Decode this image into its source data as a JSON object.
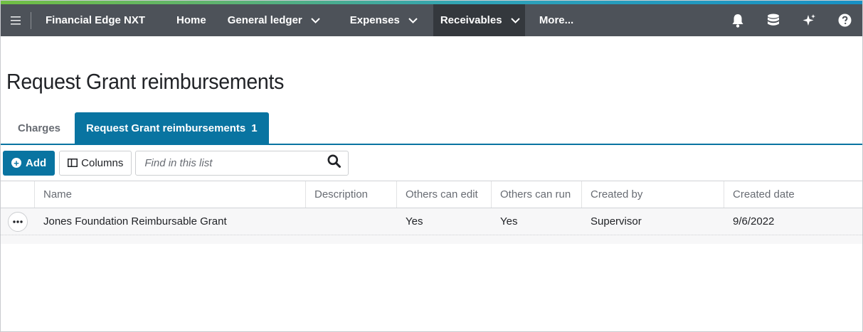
{
  "app": {
    "title": "Financial Edge NXT",
    "colors": {
      "nav_bg": "#4d5259",
      "accent": "#0974a1",
      "active_nav": "#34383d"
    }
  },
  "nav": {
    "items": [
      {
        "label": "Home",
        "has_dropdown": false
      },
      {
        "label": "General ledger",
        "has_dropdown": true
      },
      {
        "label": "Expenses",
        "has_dropdown": true
      },
      {
        "label": "Receivables",
        "has_dropdown": true,
        "active": true
      },
      {
        "label": "More...",
        "has_dropdown": false
      }
    ],
    "right_icons": [
      "bell-icon",
      "database-icon",
      "sparkle-icon",
      "help-icon"
    ]
  },
  "page": {
    "title": "Request Grant reimbursements"
  },
  "tabs": [
    {
      "label": "Charges",
      "count": ""
    },
    {
      "label": "Request Grant reimbursements",
      "count": "1",
      "active": true
    }
  ],
  "toolbar": {
    "add_label": "Add",
    "columns_label": "Columns",
    "search_placeholder": "Find in this list"
  },
  "grid": {
    "columns": [
      "Name",
      "Description",
      "Others can edit",
      "Others can run",
      "Created by",
      "Created date"
    ],
    "rows": [
      {
        "name": "Jones Foundation Reimbursable Grant",
        "description": "",
        "others_can_edit": "Yes",
        "others_can_run": "Yes",
        "created_by": "Supervisor",
        "created_date": "9/6/2022"
      }
    ]
  }
}
